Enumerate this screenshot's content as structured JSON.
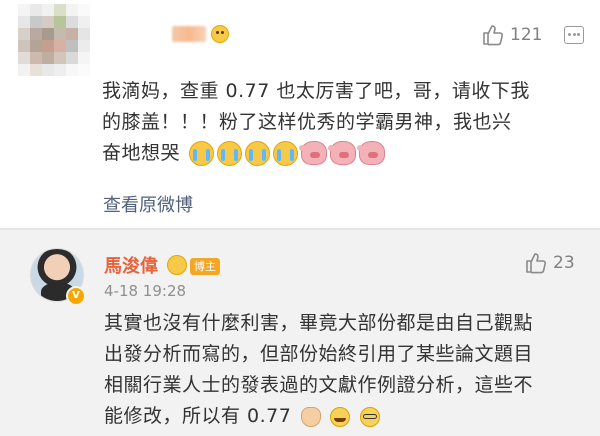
{
  "comment1": {
    "likes": "121",
    "text_lines": [
      "我滴妈，查重 0.77 也太厉害了吧，哥，请收下我",
      "的膝盖！！！粉了这样优秀的学霸男神，我也兴",
      "奋地想哭"
    ],
    "emojis": [
      "crying-face",
      "crying-face",
      "crying-face",
      "crying-face",
      "pig-crying",
      "pig-crying",
      "pig-crying"
    ],
    "link": "查看原微博"
  },
  "comment2": {
    "author": "馬浚偉",
    "badge": "博主",
    "date": "4-18 19:28",
    "likes": "23",
    "text_lines": [
      "其實也沒有什麼利害，畢竟大部份都是由自己觀點",
      "出發分析而寫的，但部份始終引用了某些論文題目",
      "相關行業人士的發表過的文獻作例證分析，這些不",
      "能修改，所以有 0.77"
    ],
    "emojis": [
      "clapping-hands",
      "laughing-face",
      "glasses-face"
    ]
  },
  "colors": {
    "author_name": "#e8623a",
    "link": "#52617d",
    "badge": "#f5a623",
    "reply_background": "#f2f2f2"
  }
}
